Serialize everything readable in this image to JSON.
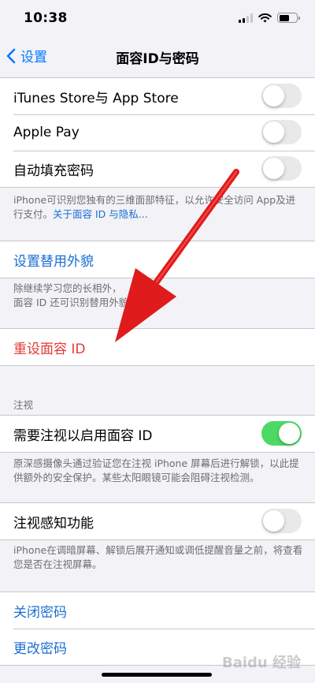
{
  "status_bar": {
    "time": "10:38"
  },
  "nav": {
    "back_label": "设置",
    "title": "面容ID与密码"
  },
  "group1": [
    {
      "label": "iTunes Store与 App Store",
      "toggle": false
    },
    {
      "label": "Apple Pay",
      "toggle": false
    },
    {
      "label": "自动填充密码",
      "toggle": false
    }
  ],
  "footnote1": {
    "text": "iPhone可识别您独有的三维面部特征，以允许安全访问 App及进行支付。",
    "link": "关于面容 ID 与隐私..."
  },
  "alt_appearance": {
    "label": "设置替用外貌"
  },
  "footnote2": {
    "line1": "除继续学习您的长相外，",
    "line2": "面容 ID 还可识别替用外貌。"
  },
  "reset": {
    "label": "重设面容 ID"
  },
  "attention_header": "注视",
  "require_attention": {
    "label": "需要注视以启用面容 ID",
    "toggle": true
  },
  "footnote3": "原深感摄像头通过验证您在注视 iPhone 屏幕后进行解锁，以此提供额外的安全保护。某些太阳眼镜可能会阻碍注视检测。",
  "attention_aware": {
    "label": "注视感知功能",
    "toggle": false
  },
  "footnote4": "iPhone在调暗屏幕、解锁后展开通知或调低提醒音量之前，将查看您是否在注视屏幕。",
  "passcode": {
    "turn_off": "关闭密码",
    "change": "更改密码"
  },
  "watermark": "Baidu 经验",
  "colors": {
    "accent": "#1a6fd1",
    "danger": "#e53935",
    "toggle_on": "#4cd964",
    "arrow": "#e01b1b"
  }
}
